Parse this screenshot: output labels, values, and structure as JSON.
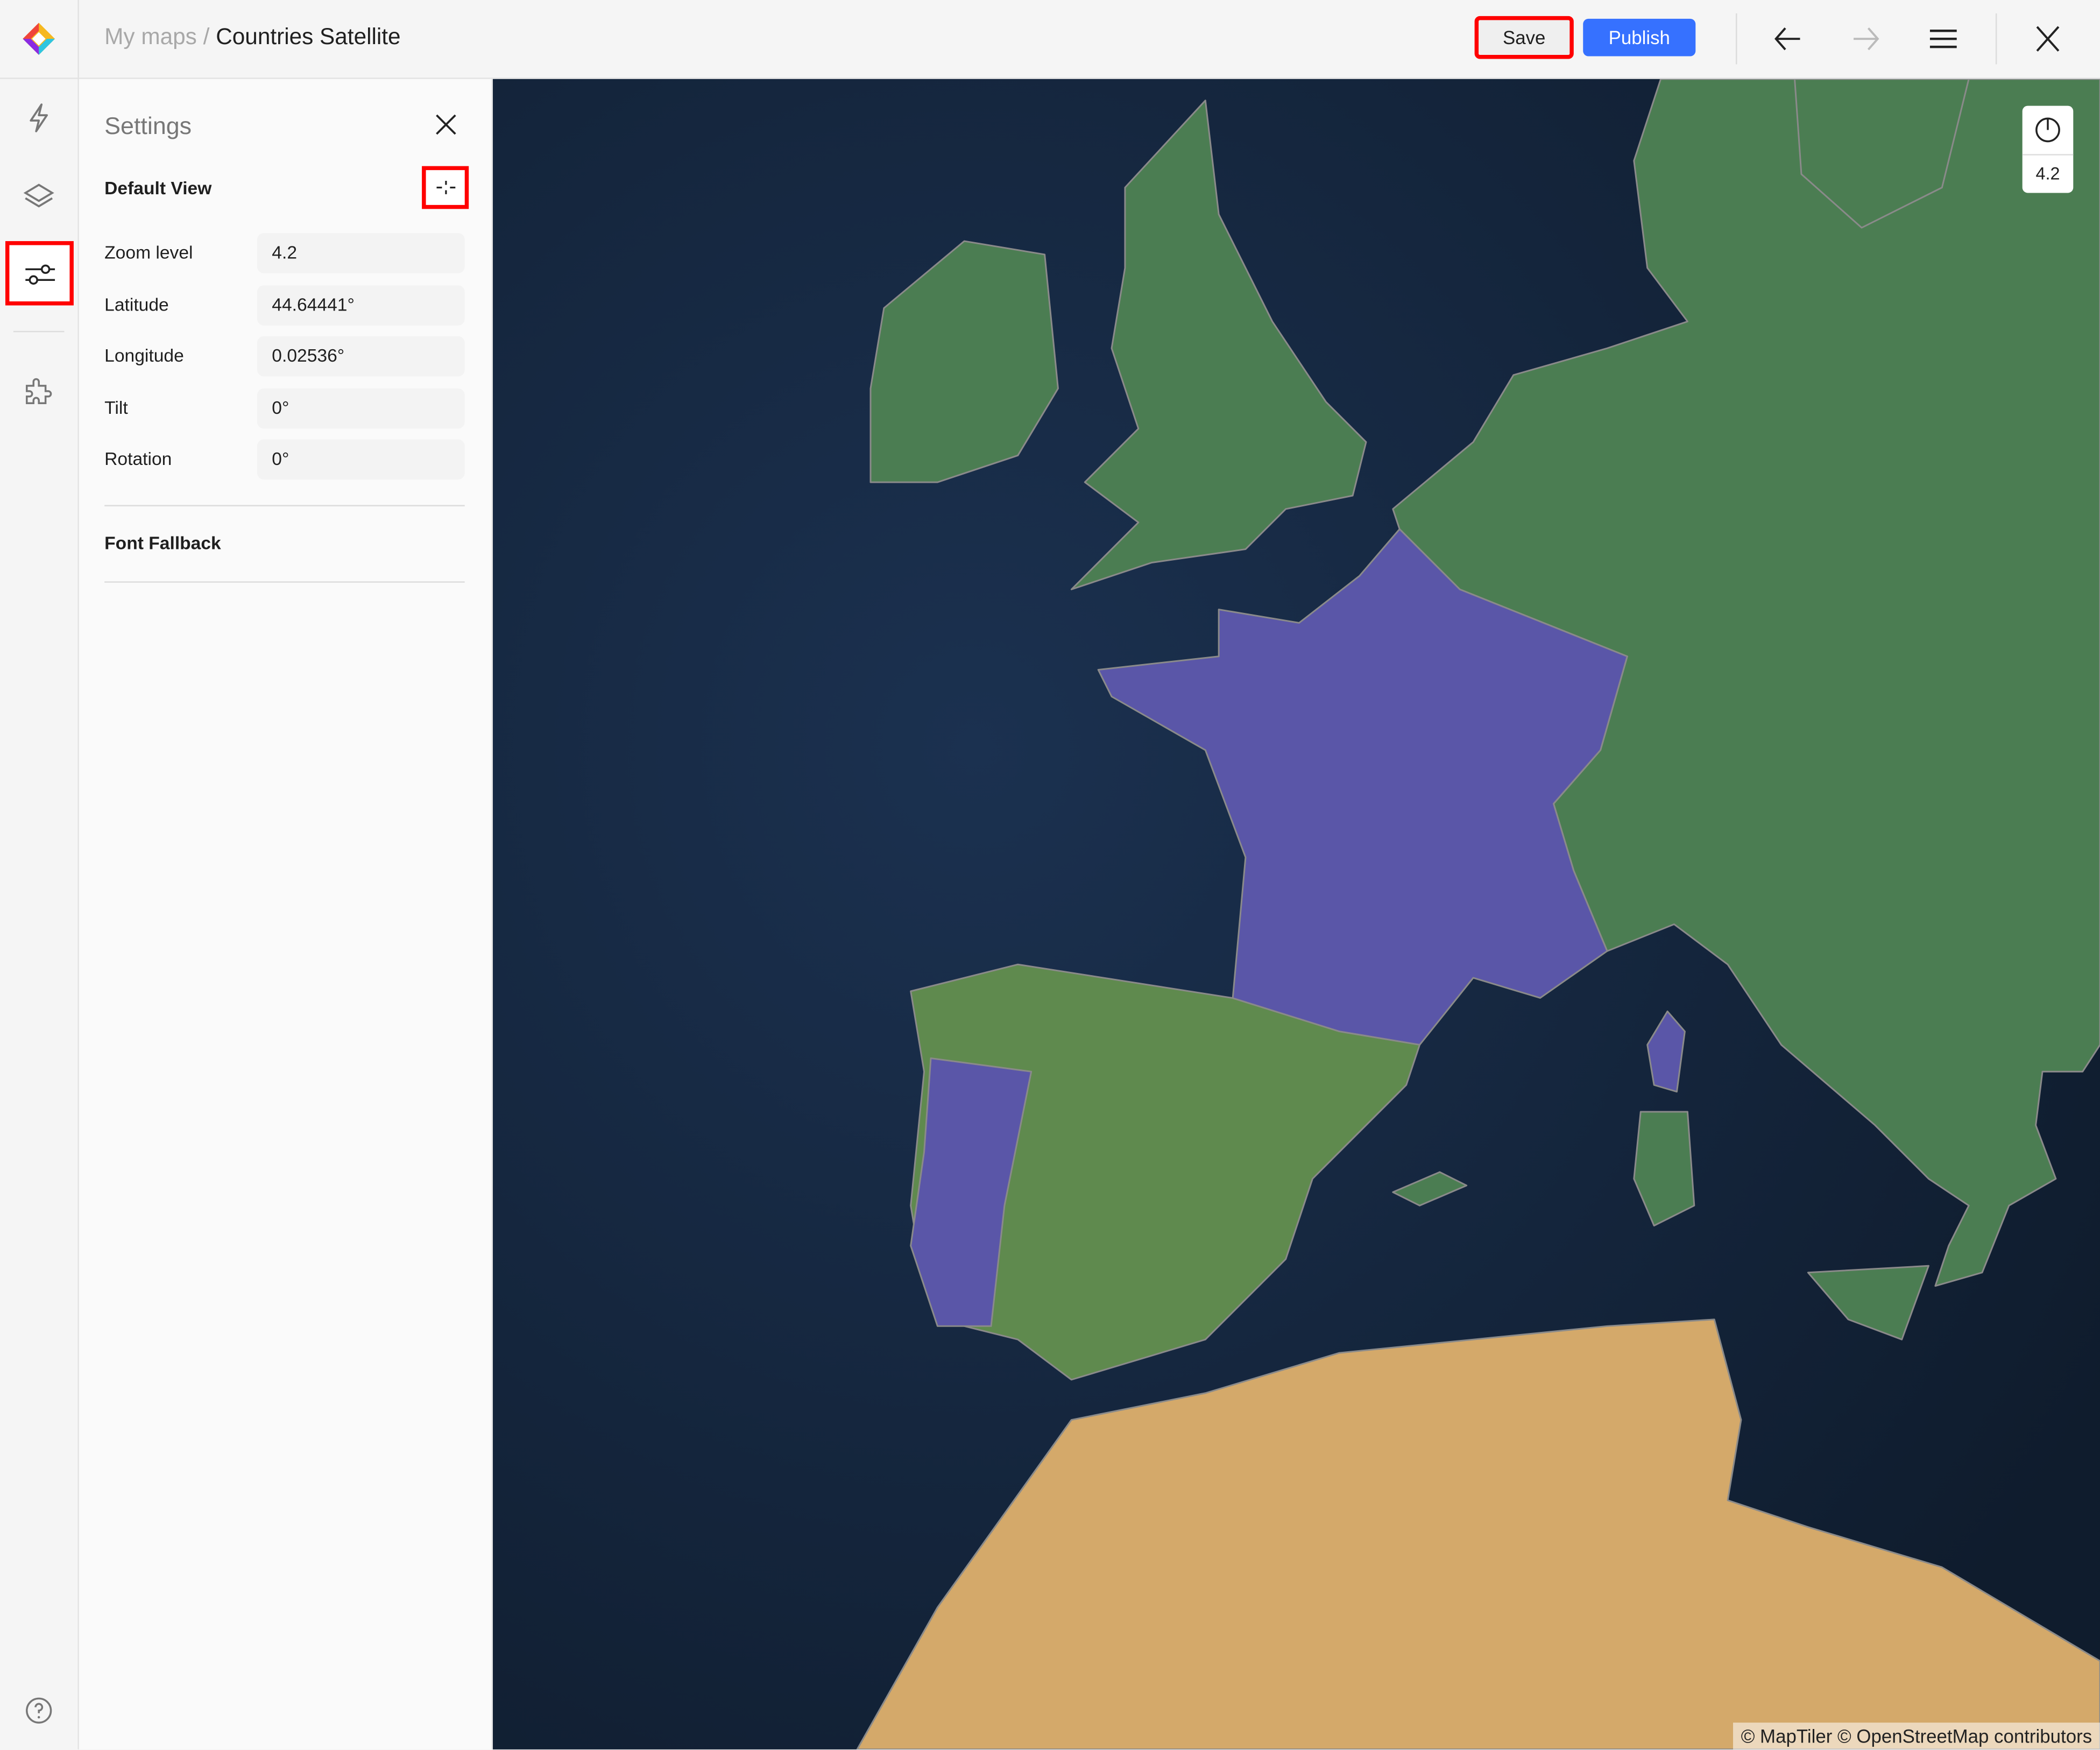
{
  "header": {
    "breadcrumb_parent": "My maps",
    "breadcrumb_sep": "/",
    "map_title": "Countries Satellite",
    "save_label": "Save",
    "publish_label": "Publish"
  },
  "settings": {
    "title": "Settings",
    "default_view_label": "Default View",
    "fields": [
      {
        "label": "Zoom level",
        "value": "4.2"
      },
      {
        "label": "Latitude",
        "value": "44.64441°"
      },
      {
        "label": "Longitude",
        "value": "0.02536°"
      },
      {
        "label": "Tilt",
        "value": "0°"
      },
      {
        "label": "Rotation",
        "value": "0°"
      }
    ],
    "font_fallback_label": "Font Fallback"
  },
  "map": {
    "zoom_value": "4.2",
    "attribution": "© MapTiler © OpenStreetMap contributors",
    "colors": {
      "sea": "#14243a",
      "land": "#4a7a4f",
      "highlight": "#5a56a8",
      "desert": "#d4a96a"
    }
  }
}
